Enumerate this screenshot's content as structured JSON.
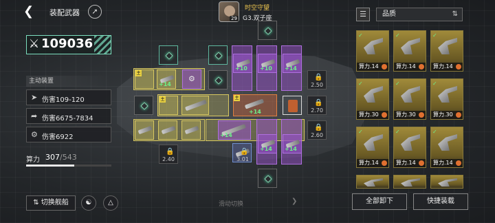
{
  "header": {
    "title": "装配武器",
    "commander_name": "时空守望",
    "commander_level": "29",
    "commander_ship": "G3.双子座"
  },
  "power": {
    "value": "109036"
  },
  "active_equipment": {
    "label": "主动装置",
    "stats": [
      {
        "icon": "wing-icon",
        "text": "伤害109-120"
      },
      {
        "icon": "missile-icon",
        "text": "伤害6675-7834"
      },
      {
        "icon": "gear-icon",
        "text": "伤害6922"
      }
    ]
  },
  "capacity": {
    "label": "算力",
    "used": "307",
    "max": "/543",
    "fraction": 0.565
  },
  "bottom": {
    "switch_ship": "切换舰船",
    "swipe_hint": "滑动切换"
  },
  "slots": {
    "master_tag": "主",
    "bonus": "+14",
    "bonus10": "+10",
    "locks": [
      "2.50",
      "2.70",
      "2.60",
      "2.40",
      "3.01"
    ]
  },
  "filter": {
    "quality_label": "品质"
  },
  "cards": [
    {
      "label": "算力.14"
    },
    {
      "label": "算力.14"
    },
    {
      "label": "算力.14"
    },
    {
      "label": "算力.30"
    },
    {
      "label": "算力.30"
    },
    {
      "label": "算力.30"
    },
    {
      "label": "算力.14"
    },
    {
      "label": "算力.14"
    },
    {
      "label": "算力.14"
    }
  ],
  "actions": {
    "unequip_all": "全部卸下",
    "quick_equip": "快捷装载"
  },
  "colors": {
    "accent": "#7de0c0",
    "purple": "#b070e0",
    "yellow": "#d8c860"
  }
}
